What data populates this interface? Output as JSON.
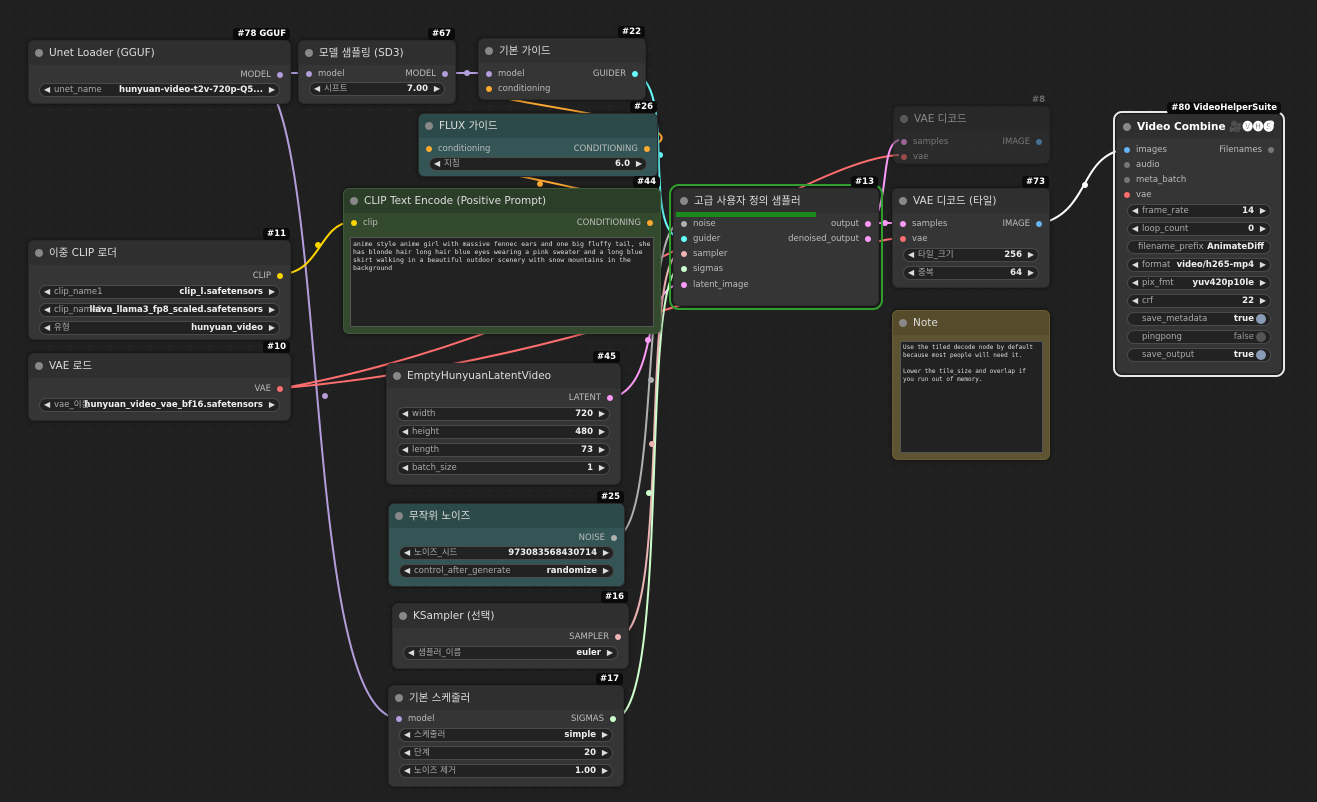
{
  "colors": {
    "model": "#b39ddb",
    "clip": "#ffd500",
    "vae": "#ff6e6e",
    "conditioning": "#ffa931",
    "latent": "#ff9cf9",
    "guider": "#66ffff",
    "sigmas": "#cdffcd",
    "sampler": "#ecb4b4",
    "noise": "#b0b0b0",
    "image": "#64b5f6"
  },
  "nodes": {
    "unet": {
      "badge": "#78 GGUF",
      "title": "Unet Loader (GGUF)",
      "output": "MODEL",
      "w_label": "unet_name",
      "w_value": "hunyuan-video-t2v-720p-Q5..."
    },
    "modelsamp": {
      "badge": "#67",
      "title": "모델 샘플링 (SD3)",
      "input": "model",
      "output": "MODEL",
      "w_label": "시프트",
      "w_value": "7.00"
    },
    "basicguider": {
      "badge": "#22",
      "title": "기본 가이드",
      "in1": "model",
      "in2": "conditioning",
      "output": "GUIDER"
    },
    "flux": {
      "badge": "#26",
      "title": "FLUX 가이드",
      "input": "conditioning",
      "output": "CONDITIONING",
      "w_label": "지침",
      "w_value": "6.0"
    },
    "clipenc": {
      "badge": "#44",
      "title": "CLIP Text Encode (Positive Prompt)",
      "input": "clip",
      "output": "CONDITIONING",
      "text": "anime style anime girl with massive fennec ears and one big fluffy tail, she has blonde hair long hair blue eyes wearing a pink sweater and a long blue skirt walking in a beautiful outdoor scenery with snow mountains in the background"
    },
    "dualclip": {
      "badge": "#11",
      "title": "이중 CLIP 로더",
      "output": "CLIP",
      "w1_label": "clip_name1",
      "w1_value": "clip_l.safetensors",
      "w2_label": "clip_name2",
      "w2_value": "llava_llama3_fp8_scaled.safetensors",
      "w3_label": "유형",
      "w3_value": "hunyuan_video"
    },
    "vaeload": {
      "badge": "#10",
      "title": "VAE 로드",
      "output": "VAE",
      "w_label": "vae_이름",
      "w_value": "hunyuan_video_vae_bf16.safetensors"
    },
    "latent": {
      "badge": "#45",
      "title": "EmptyHunyuanLatentVideo",
      "output": "LATENT",
      "widgets": [
        {
          "label": "width",
          "value": "720"
        },
        {
          "label": "height",
          "value": "480"
        },
        {
          "label": "length",
          "value": "73"
        },
        {
          "label": "batch_size",
          "value": "1"
        }
      ]
    },
    "noise": {
      "badge": "#25",
      "title": "무작위 노이즈",
      "output": "NOISE",
      "w1_label": "노이즈_시드",
      "w1_value": "973083568430714",
      "w2_label": "control_after_generate",
      "w2_value": "randomize"
    },
    "ksampler": {
      "badge": "#16",
      "title": "KSampler (선택)",
      "output": "SAMPLER",
      "w_label": "샘플러_이름",
      "w_value": "euler"
    },
    "scheduler": {
      "badge": "#17",
      "title": "기본 스케줄러",
      "input": "model",
      "output": "SIGMAS",
      "widgets": [
        {
          "label": "스케줄러",
          "value": "simple"
        },
        {
          "label": "단계",
          "value": "20"
        },
        {
          "label": "노이즈 제거",
          "value": "1.00"
        }
      ]
    },
    "custsamp": {
      "badge": "#13",
      "title": "고급 사용자 정의 샘플러",
      "inputs": [
        "noise",
        "guider",
        "sampler",
        "sigmas",
        "latent_image"
      ],
      "out1": "output",
      "out2": "denoised_output",
      "progress": 0.7
    },
    "vaedec": {
      "badge": "#8",
      "title": "VAE 디코드",
      "in1": "samples",
      "in2": "vae",
      "output": "IMAGE"
    },
    "vaetiled": {
      "badge": "#73",
      "title": "VAE 디코드 (타일)",
      "in1": "samples",
      "in2": "vae",
      "output": "IMAGE",
      "w1_label": "타일_크기",
      "w1_value": "256",
      "w2_label": "중복",
      "w2_value": "64"
    },
    "note": {
      "title": "Note",
      "text": "Use the tiled decode node by default because most people will need it.\n\nLower the tile_size and overlap if you run out of memory."
    },
    "vcombine": {
      "badge": "#80 VideoHelperSuite",
      "title": "Video Combine 🎥🅥🅗🅢",
      "help": "?",
      "inputs": [
        "images",
        "audio",
        "meta_batch",
        "vae"
      ],
      "output": "Filenames",
      "widgets": [
        {
          "label": "frame_rate",
          "value": "14",
          "kind": "num"
        },
        {
          "label": "loop_count",
          "value": "0",
          "kind": "num"
        },
        {
          "label": "filename_prefix",
          "value": "AnimateDiff",
          "kind": "text"
        },
        {
          "label": "format",
          "value": "video/h265-mp4",
          "kind": "combo"
        },
        {
          "label": "pix_fmt",
          "value": "yuv420p10le",
          "kind": "combo"
        },
        {
          "label": "crf",
          "value": "22",
          "kind": "num"
        },
        {
          "label": "save_metadata",
          "value": "true",
          "kind": "toggle"
        },
        {
          "label": "pingpong",
          "value": "false",
          "kind": "toggle"
        },
        {
          "label": "save_output",
          "value": "true",
          "kind": "toggle"
        }
      ]
    }
  }
}
